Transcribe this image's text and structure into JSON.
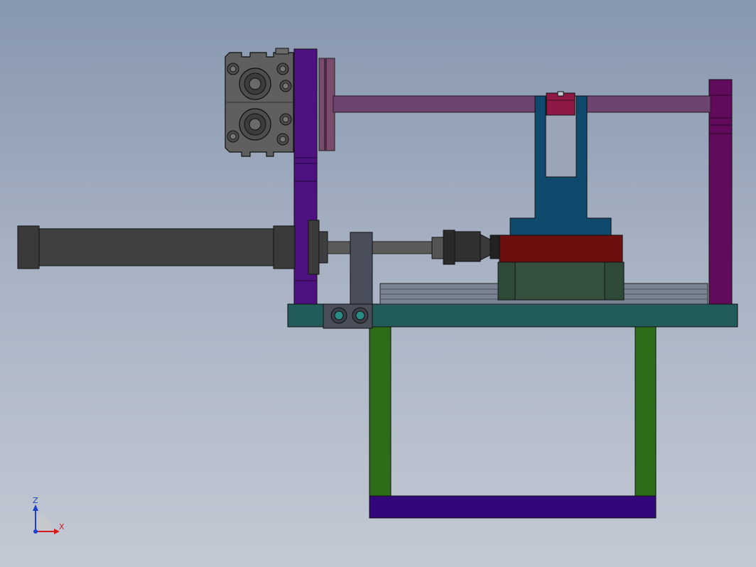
{
  "triad": {
    "z_label": "Z",
    "x_label": "X",
    "z_color": "#1c3fd0",
    "x_color": "#d41c1c"
  },
  "colors": {
    "background_top": "#8797ae",
    "background_bottom": "#c3c9d4",
    "base_plate": "#225c5a",
    "legs": "#2d6d1a",
    "bottom_bar": "#32077a",
    "left_upright": "#4d1280",
    "right_upright": "#620b5c",
    "guide_rod": "#6d4470",
    "air_cylinder": "#3a3a3a",
    "valve_block": "#5f5f5f",
    "blue_bracket": "#0f4a6d",
    "red_slide_table": "#6b0f0f",
    "green_slide_block": "#2f4a38",
    "rail": "#7a8391",
    "clevis": "#4a4e5a",
    "chuck": "#2a2a2a"
  }
}
